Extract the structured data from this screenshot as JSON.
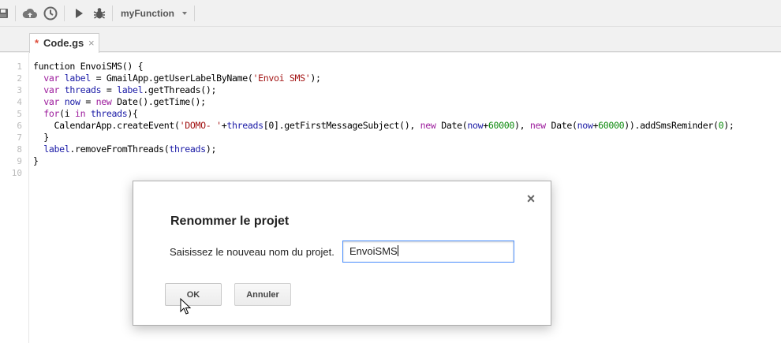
{
  "toolbar": {
    "function_select": "myFunction",
    "icons": [
      "save-icon",
      "cloud-upload-icon",
      "clock-icon",
      "run-icon",
      "debug-icon"
    ]
  },
  "tab": {
    "modified_marker": "*",
    "name": "Code.gs",
    "close": "×"
  },
  "editor": {
    "line_numbers": [
      "1",
      "2",
      "3",
      "4",
      "5",
      "6",
      "7",
      "8",
      "9",
      "10"
    ]
  },
  "dialog": {
    "close": "×",
    "title": "Renommer le projet",
    "label": "Saisissez le nouveau nom du projet.",
    "input_value": "EnvoiSMS",
    "ok_label": "OK",
    "cancel_label": "Annuler"
  },
  "colors": {
    "keyword": "#9d1d9d",
    "variable": "#1a1aa6",
    "string": "#a31515",
    "number": "#0c8a0c",
    "focus_border": "#4d90fe",
    "modified_marker": "#dd4b39"
  }
}
